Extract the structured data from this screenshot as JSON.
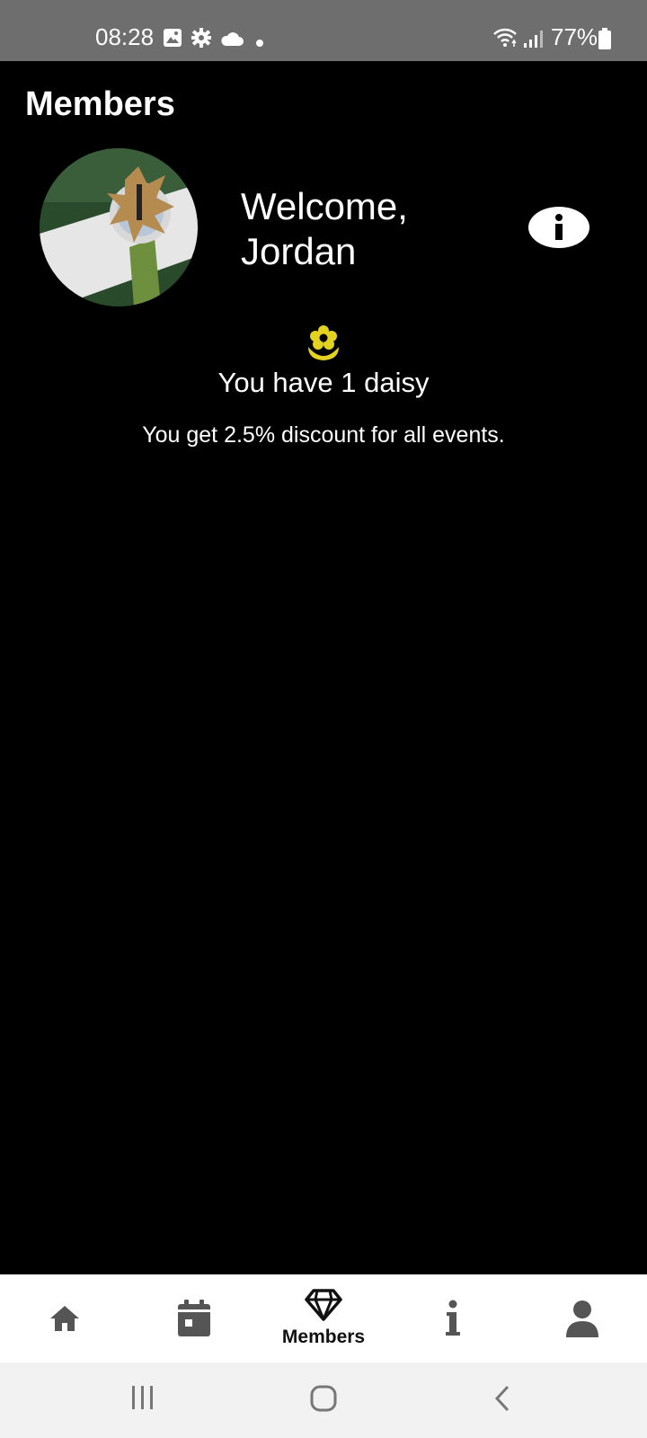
{
  "status_bar": {
    "time": "08:28",
    "battery_percent": "77%",
    "icons": [
      "gallery-icon",
      "settings-icon",
      "cloud-icon",
      "dot-icon",
      "wifi-icon",
      "signal-icon",
      "battery-icon"
    ]
  },
  "header": {
    "title": "Members"
  },
  "profile": {
    "welcome_line1": "Welcome,",
    "welcome_line2": "Jordan",
    "info_icon": "info-icon"
  },
  "daisy": {
    "icon": "daisy-flower-icon",
    "icon_color": "#e3d21f",
    "count_text": "You have 1 daisy",
    "discount_text": "You get 2.5% discount for all events."
  },
  "bottom_nav": {
    "items": [
      {
        "icon": "home-icon",
        "label": ""
      },
      {
        "icon": "calendar-icon",
        "label": ""
      },
      {
        "icon": "diamond-icon",
        "label": "Members",
        "active": true
      },
      {
        "icon": "info-icon",
        "label": ""
      },
      {
        "icon": "person-icon",
        "label": ""
      }
    ]
  },
  "system_nav": {
    "buttons": [
      "recents-icon",
      "home-circle-icon",
      "back-icon"
    ]
  },
  "colors": {
    "background": "#000000",
    "status_bar": "#6e6e6e",
    "nav_background": "#ffffff",
    "nav_icon": "#555555",
    "accent_daisy": "#e3d21f"
  }
}
